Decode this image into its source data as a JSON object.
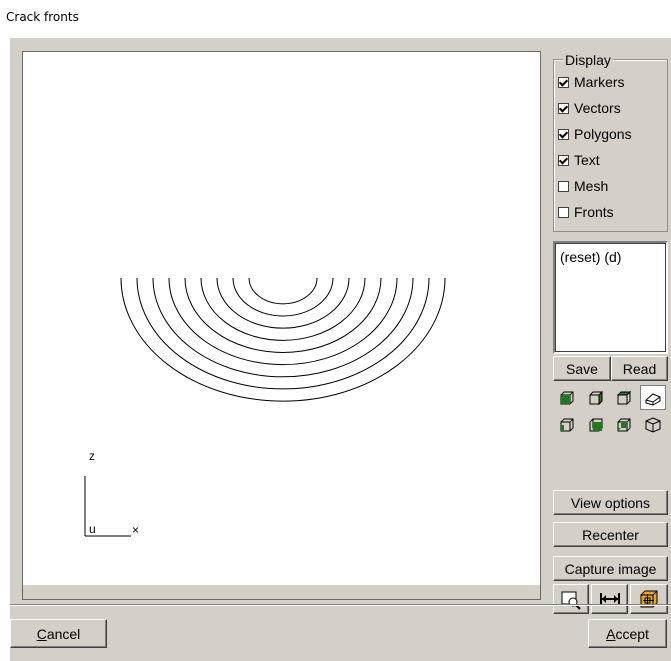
{
  "window": {
    "title": "Crack fronts"
  },
  "display": {
    "group_title": "Display",
    "options": [
      {
        "label": "Markers",
        "checked": true
      },
      {
        "label": "Vectors",
        "checked": true
      },
      {
        "label": "Polygons",
        "checked": true
      },
      {
        "label": "Text",
        "checked": true
      },
      {
        "label": "Mesh",
        "checked": false
      },
      {
        "label": "Fronts",
        "checked": false
      }
    ]
  },
  "views_list": {
    "items": [
      "(reset) (d)"
    ]
  },
  "buttons": {
    "save": "Save",
    "read": "Read",
    "view_options": "View options",
    "recenter": "Recenter",
    "capture_image": "Capture image",
    "cancel_mnemonic": "C",
    "cancel_rest": "ancel",
    "accept_mnemonic": "A",
    "accept_rest": "ccept"
  },
  "view_icons": [
    "view-front-icon",
    "view-left-icon",
    "view-top-icon",
    "view-iso-active-icon",
    "view-back-icon",
    "view-right-icon",
    "view-bottom-icon",
    "view-iso-icon"
  ],
  "tool_icons": [
    "zoom-icon",
    "fit-width-icon",
    "bounding-box-icon"
  ],
  "triad": {
    "z": "z",
    "u": "u",
    "x": "×"
  },
  "colors": {
    "accent_green": "#1f7a1f",
    "box_orange": "#e8a624"
  }
}
